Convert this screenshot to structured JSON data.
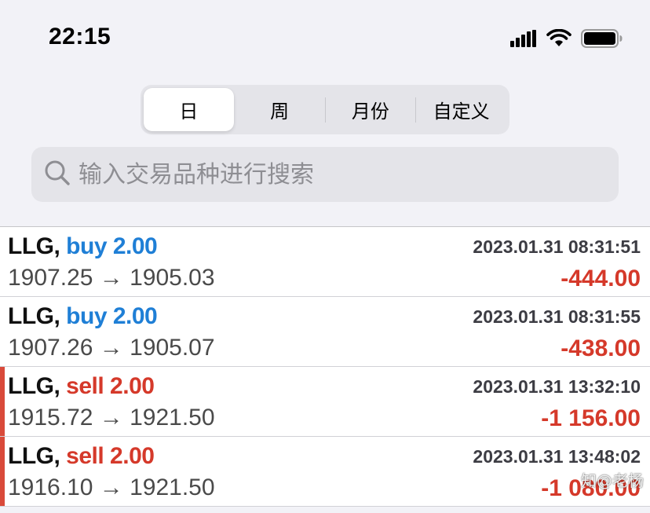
{
  "status_bar": {
    "time": "22:15",
    "icons": [
      "cellular-signal-icon",
      "wifi-icon",
      "battery-icon"
    ]
  },
  "period_tabs": {
    "items": [
      {
        "label": "日",
        "selected": true
      },
      {
        "label": "周",
        "selected": false
      },
      {
        "label": "月份",
        "selected": false
      },
      {
        "label": "自定义",
        "selected": false
      }
    ]
  },
  "search": {
    "placeholder": "输入交易品种进行搜索",
    "value": "",
    "icon": "search-icon"
  },
  "trades": [
    {
      "symbol": "LLG,",
      "side": "buy",
      "side_label": "buy 2.00",
      "time": "2023.01.31 08:31:51",
      "prices": "1907.25 → 1905.03",
      "profit": "-444.00",
      "marked": false
    },
    {
      "symbol": "LLG,",
      "side": "buy",
      "side_label": "buy 2.00",
      "time": "2023.01.31 08:31:55",
      "prices": "1907.26 → 1905.07",
      "profit": "-438.00",
      "marked": false
    },
    {
      "symbol": "LLG,",
      "side": "sell",
      "side_label": "sell 2.00",
      "time": "2023.01.31 13:32:10",
      "prices": "1915.72 → 1921.50",
      "profit": "-1 156.00",
      "marked": true
    },
    {
      "symbol": "LLG,",
      "side": "sell",
      "side_label": "sell 2.00",
      "time": "2023.01.31 13:48:02",
      "prices": "1916.10 → 1921.50",
      "profit": "-1 080.00",
      "marked": true
    }
  ],
  "watermark": "知@老杨",
  "colors": {
    "buy": "#1f7fd6",
    "sell": "#d5392a",
    "loss": "#d5392a",
    "marker": "#d94a3a",
    "background": "#f2f2f7"
  }
}
